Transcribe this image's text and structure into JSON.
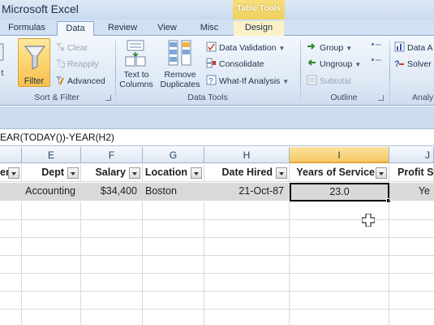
{
  "window": {
    "title": "Microsoft Excel"
  },
  "contextual_tab": {
    "label": "Table Tools"
  },
  "tabs": [
    "Formulas",
    "Data",
    "Review",
    "View",
    "Misc",
    "Design"
  ],
  "ribbon": {
    "sort_filter": {
      "filter": "Filter",
      "clear": "Clear",
      "reapply": "Reapply",
      "advanced": "Advanced",
      "group_label": "Sort & Filter"
    },
    "data_tools": {
      "text_to_columns_1": "Text to",
      "text_to_columns_2": "Columns",
      "remove_duplicates_1": "Remove",
      "remove_duplicates_2": "Duplicates",
      "data_validation": "Data Validation",
      "consolidate": "Consolidate",
      "what_if": "What-If Analysis",
      "group_label": "Data Tools"
    },
    "outline": {
      "group": "Group",
      "ungroup": "Ungroup",
      "subtotal": "Subtotal",
      "group_label": "Outline"
    },
    "analysis": {
      "data_analysis": "Data A",
      "solver": "Solver",
      "group_label": "Analy"
    }
  },
  "formula_bar": {
    "text": "EAR(TODAY())-YEAR(H2)"
  },
  "columns": [
    "E",
    "F",
    "G",
    "H",
    "I",
    "J"
  ],
  "headers": {
    "d": "er",
    "e": "Dept",
    "f": "Salary",
    "g": "Location",
    "h": "Date Hired",
    "i": "Years of Service",
    "j": "Profit S"
  },
  "row2": {
    "e": "Accounting",
    "f": "$34,400",
    "g": "Boston",
    "h": "21-Oct-87",
    "i": "23.0",
    "j": "Ye"
  },
  "colors": {
    "selected_col": "#f6c964",
    "filter_active": "#f8c14a"
  }
}
